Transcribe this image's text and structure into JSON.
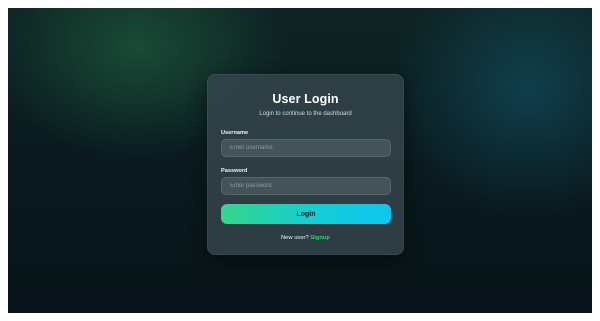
{
  "login_card": {
    "title": "User Login",
    "subtitle": "Login to continue to the dashboard",
    "username": {
      "label": "Username",
      "placeholder": "Enter username",
      "value": ""
    },
    "password": {
      "label": "Password",
      "placeholder": "Enter password",
      "value": ""
    },
    "login_button_label": "Login",
    "signup_prompt": "New user?",
    "signup_link_label": "Signup"
  },
  "colors": {
    "background": "#0a1b20",
    "card": "#37484e",
    "button_gradient_start": "#34d68b",
    "button_gradient_end": "#0ec6f0",
    "signup_link": "#2fd17a"
  }
}
